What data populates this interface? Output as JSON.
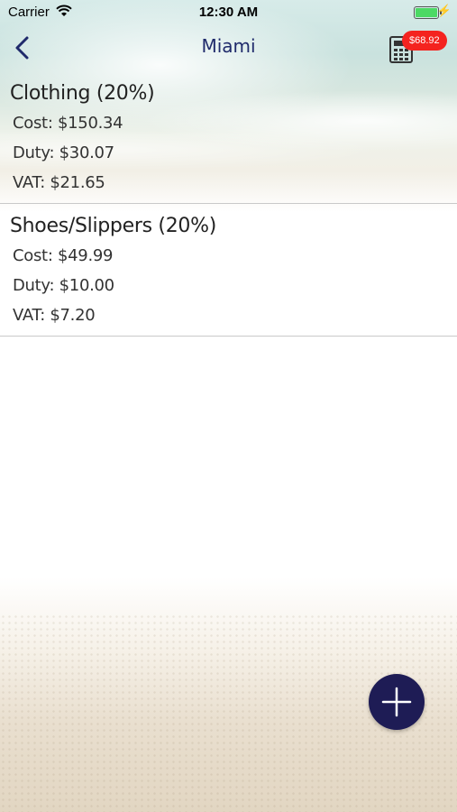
{
  "status_bar": {
    "carrier": "Carrier",
    "time": "12:30 AM"
  },
  "nav": {
    "title": "Miami",
    "total_badge": "$68.92"
  },
  "items": [
    {
      "title": "Clothing (20%)",
      "cost": "Cost: $150.34",
      "duty": "Duty: $30.07",
      "vat": "VAT: $21.65"
    },
    {
      "title": "Shoes/Slippers (20%)",
      "cost": "Cost: $49.99",
      "duty": "Duty: $10.00",
      "vat": "VAT: $7.20"
    }
  ],
  "colors": {
    "accent": "#1f2a6b",
    "badge": "#f4231f",
    "fab": "#1e1c55"
  }
}
